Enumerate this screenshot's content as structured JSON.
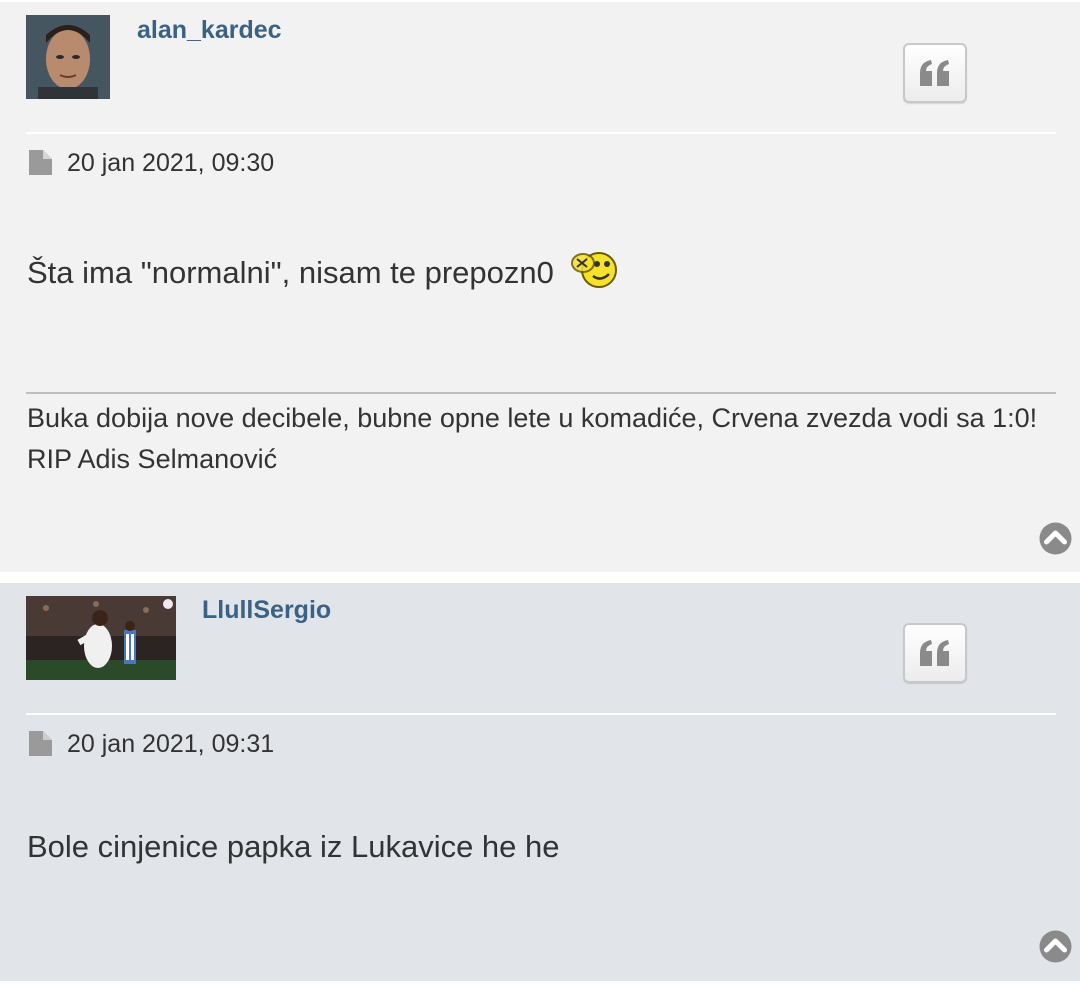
{
  "posts": [
    {
      "author": "alan_kardec",
      "date": "20 jan 2021, 09:30",
      "content": "Šta ima \"normalni\", nisam te prepozn0",
      "smiley_icon": "headbang-smiley-icon",
      "signature_lines": [
        "Buka dobija nove decibele, bubne opne lete u komadiće, Crvena zvezda vodi sa 1:0!",
        "RIP Adis Selmanović"
      ]
    },
    {
      "author": "LlullSergio",
      "date": "20 jan 2021, 09:31",
      "content": "Bole cinjenice papka iz Lukavice he he"
    }
  ],
  "icons": {
    "quote": "quote-icon",
    "post": "file-icon",
    "back_to_top": "chevron-up-circle-icon"
  },
  "colors": {
    "username": "#3a6186",
    "post_bg_1": "#f2f2f2",
    "post_bg_2": "#e1e4e8"
  }
}
